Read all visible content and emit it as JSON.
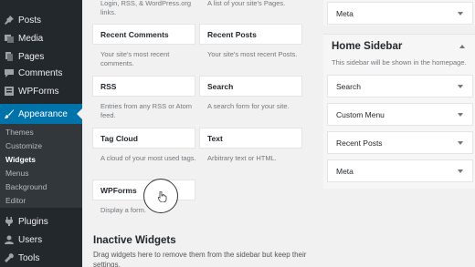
{
  "menu": {
    "posts": "Posts",
    "media": "Media",
    "pages": "Pages",
    "comments": "Comments",
    "wpforms": "WPForms",
    "appearance": "Appearance",
    "submenu": [
      "Themes",
      "Customize",
      "Widgets",
      "Menus",
      "Background",
      "Editor"
    ],
    "plugins": "Plugins",
    "users": "Users",
    "tools": "Tools"
  },
  "widgets": {
    "top_desc_left": "Login, RSS, & WordPress.org links.",
    "top_desc_right": "A list of your site's Pages.",
    "recent_comments": "Recent Comments",
    "recent_comments_desc": "Your site's most recent comments.",
    "recent_posts": "Recent Posts",
    "recent_posts_desc": "Your site's most recent Posts.",
    "rss": "RSS",
    "rss_desc": "Entries from any RSS or Atom feed.",
    "search": "Search",
    "search_desc": "A search form for your site.",
    "tag_cloud": "Tag Cloud",
    "tag_cloud_desc": "A cloud of your most used tags.",
    "text": "Text",
    "text_desc": "Arbitrary text or HTML.",
    "wpforms": "WPForms",
    "wpforms_desc": "Display a form."
  },
  "inactive": {
    "title": "Inactive Widgets",
    "desc": "Drag widgets here to remove them from the sidebar but keep their settings."
  },
  "sidebar_top": {
    "meta": "Meta"
  },
  "home_sidebar": {
    "title": "Home Sidebar",
    "desc": "This sidebar will be shown in the homepage.",
    "items": [
      "Search",
      "Custom Menu",
      "Recent Posts",
      "Meta"
    ]
  },
  "colors": {
    "admin_bg": "#23282d",
    "submenu_bg": "#32373c",
    "accent": "#0073aa",
    "page_bg": "#f1f1f1"
  }
}
